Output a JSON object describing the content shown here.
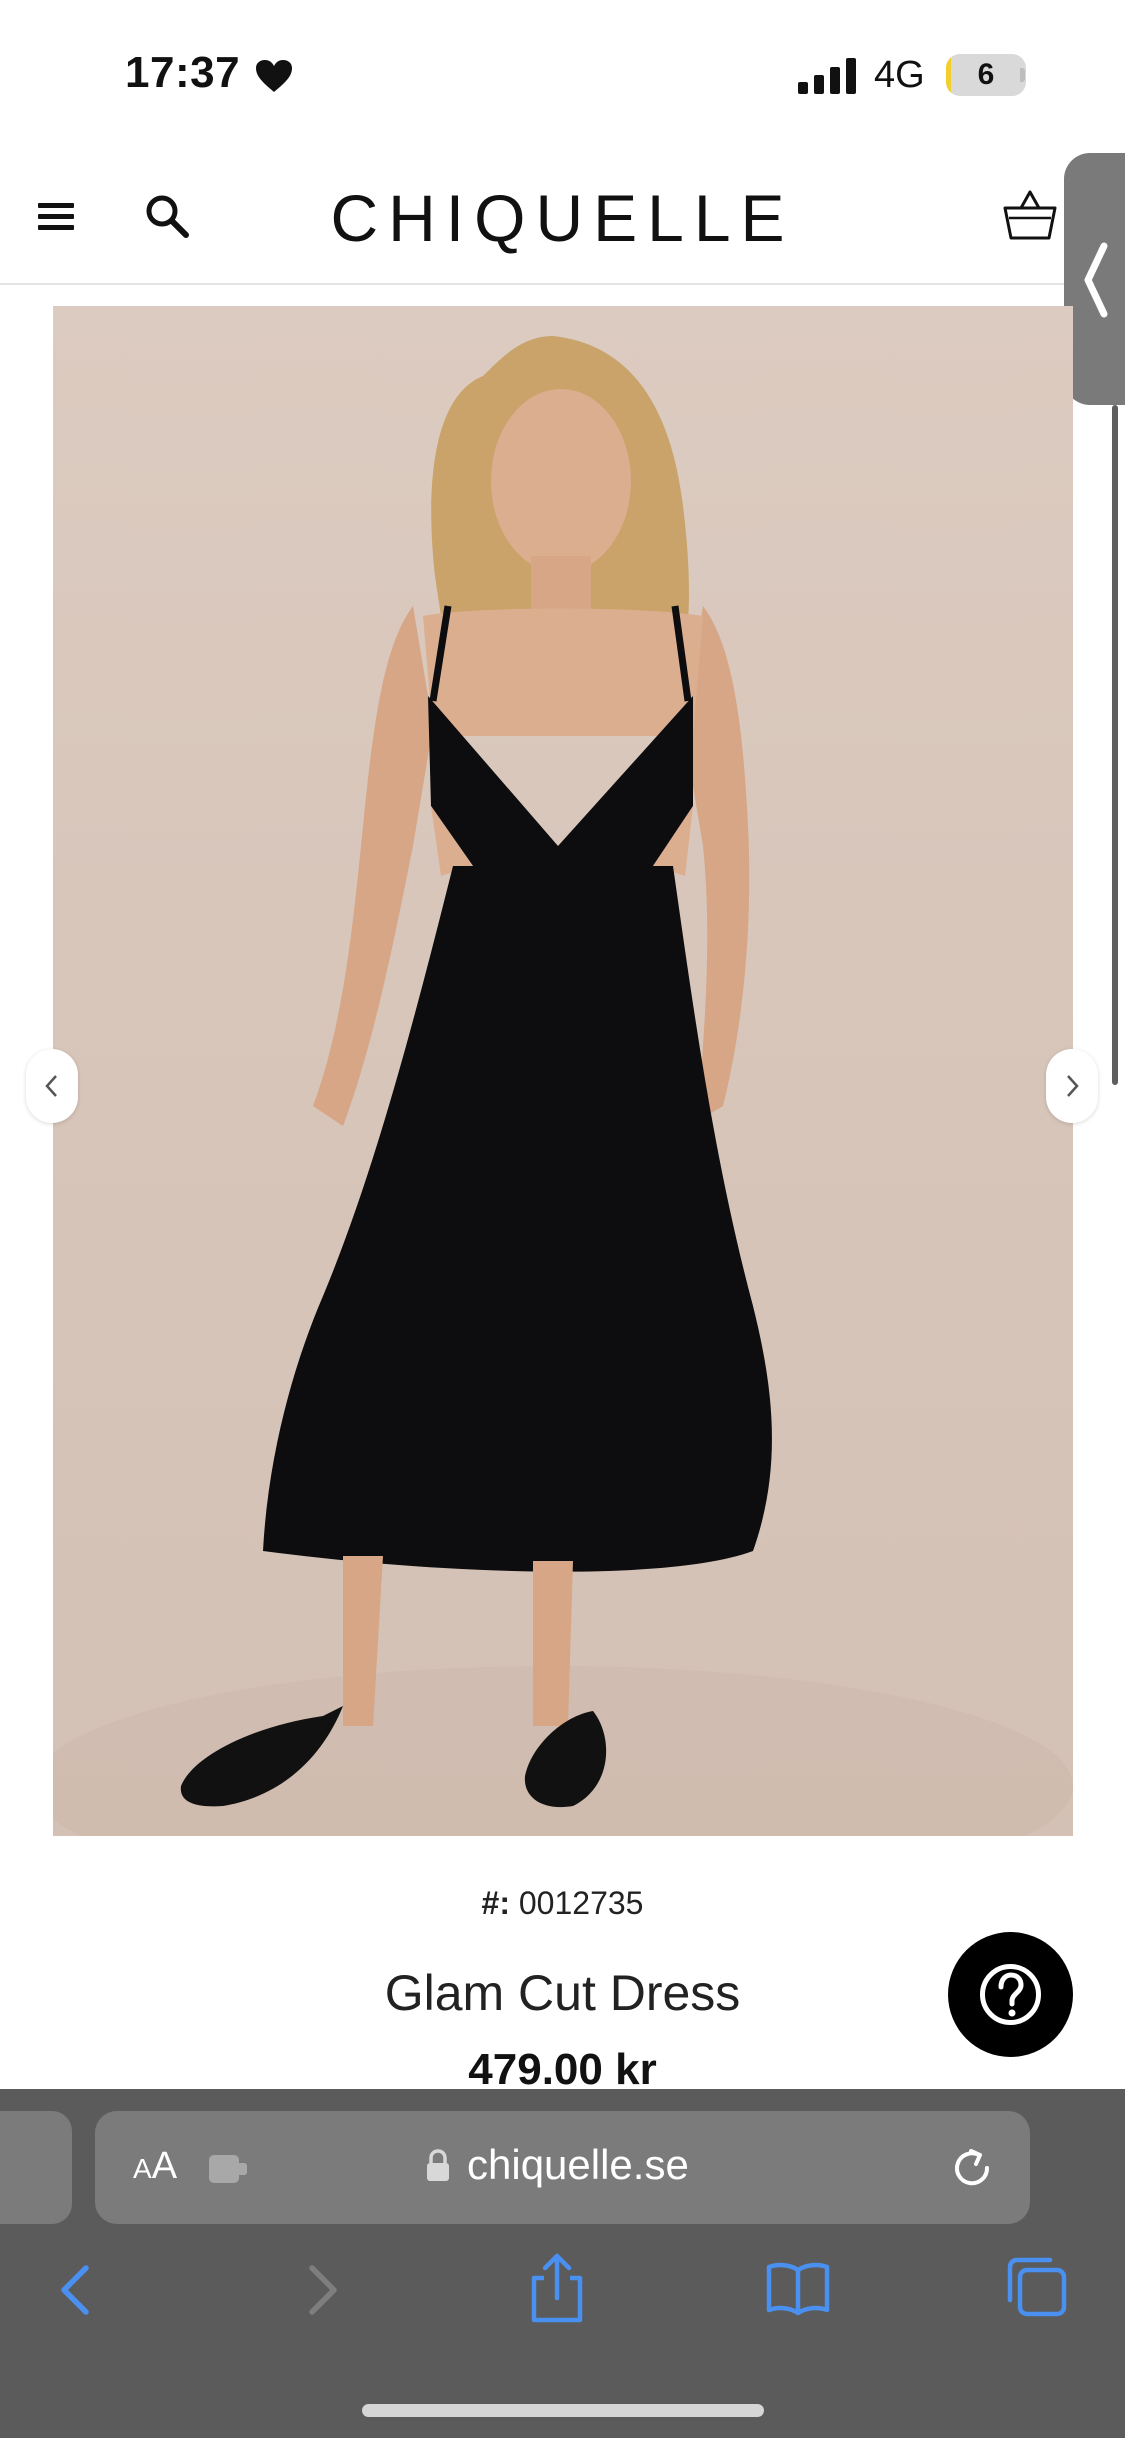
{
  "status_bar": {
    "time": "17:37",
    "network": "4G",
    "battery_level": "6",
    "battery_fraction": 0.06,
    "heart_icon": "heart-icon",
    "signal_icon": "cellular-signal-icon"
  },
  "header": {
    "brand": "CHIQUELLE",
    "menu_icon": "hamburger-menu-icon",
    "search_icon": "search-icon",
    "cart_icon": "shopping-basket-icon"
  },
  "product": {
    "sku_prefix": "#:",
    "sku": "0012735",
    "title": "Glam Cut Dress",
    "price": "479.00 kr",
    "image_description_icon": "product-photo",
    "prev_icon": "chevron-left-icon",
    "next_icon": "chevron-right-icon"
  },
  "help_button": {
    "icon": "question-mark-icon"
  },
  "browser": {
    "aa_label_small": "A",
    "aa_label_large": "A",
    "url": "chiquelle.se",
    "icons": [
      "extension-icon",
      "lock-icon",
      "reload-icon",
      "back-icon",
      "forward-icon",
      "share-icon",
      "bookmarks-icon",
      "tabs-icon"
    ]
  },
  "colors": {
    "accent_blue": "#4a90f0",
    "safari_bar": "#5b5b5b",
    "address_bar": "#7b7b7b",
    "battery_fill": "#f2cf2c"
  }
}
